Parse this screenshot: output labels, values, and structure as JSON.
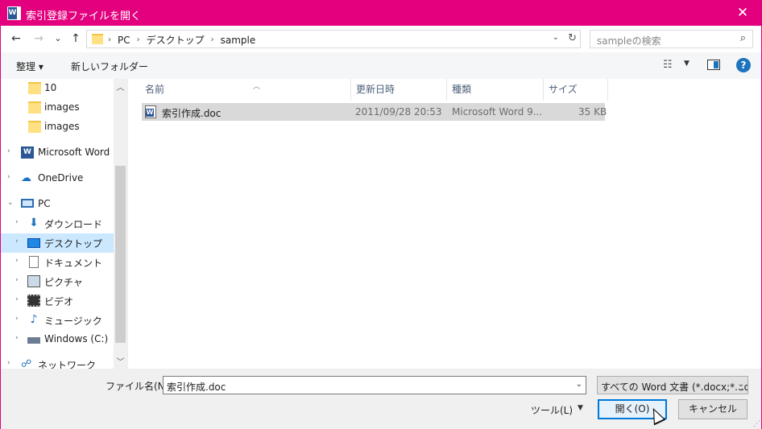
{
  "titlebar": {
    "title": "索引登録ファイルを開く",
    "app_icon_letter": "W",
    "close_glyph": "✕",
    "color": "#e3007e"
  },
  "nav": {
    "back_glyph": "←",
    "forward_glyph": "→",
    "recent_glyph": "⌄",
    "up_glyph": "↑",
    "breadcrumbs": [
      "PC",
      "デスクトップ",
      "sample"
    ],
    "search_placeholder": "sampleの検索"
  },
  "toolbar": {
    "organize": "整理 ▾",
    "new_folder": "新しいフォルダー"
  },
  "sidebar": {
    "items": [
      {
        "label": "10",
        "icon": "folder-icon"
      },
      {
        "label": "images",
        "icon": "folder-icon"
      },
      {
        "label": "images",
        "icon": "folder-icon"
      },
      {
        "label": "Microsoft Word",
        "icon": "word-icon"
      },
      {
        "label": "OneDrive",
        "icon": "onedrive-icon"
      },
      {
        "label": "PC",
        "icon": "pc-icon"
      },
      {
        "label": "ダウンロード",
        "icon": "download-icon"
      },
      {
        "label": "デスクトップ",
        "icon": "desktop-icon",
        "selected": true
      },
      {
        "label": "ドキュメント",
        "icon": "documents-icon"
      },
      {
        "label": "ピクチャ",
        "icon": "pictures-icon"
      },
      {
        "label": "ビデオ",
        "icon": "video-icon"
      },
      {
        "label": "ミュージック",
        "icon": "music-icon"
      },
      {
        "label": "Windows (C:)",
        "icon": "drive-icon"
      },
      {
        "label": "ネットワーク",
        "icon": "network-icon"
      }
    ]
  },
  "filelist": {
    "columns": [
      "名前",
      "更新日時",
      "種類",
      "サイズ"
    ],
    "rows": [
      {
        "name": "索引作成.doc",
        "modified": "2011/09/28 20:53",
        "type": "Microsoft Word 9...",
        "size": "35 KB"
      }
    ]
  },
  "footer": {
    "filename_label": "ファイル名(N):",
    "filename_value": "索引作成.doc",
    "filetype_value": "すべての Word 文書 (*.docx;*.doc",
    "tools_label": "ツール(L)",
    "open_button": "開く(O)",
    "cancel_button": "キャンセル"
  }
}
